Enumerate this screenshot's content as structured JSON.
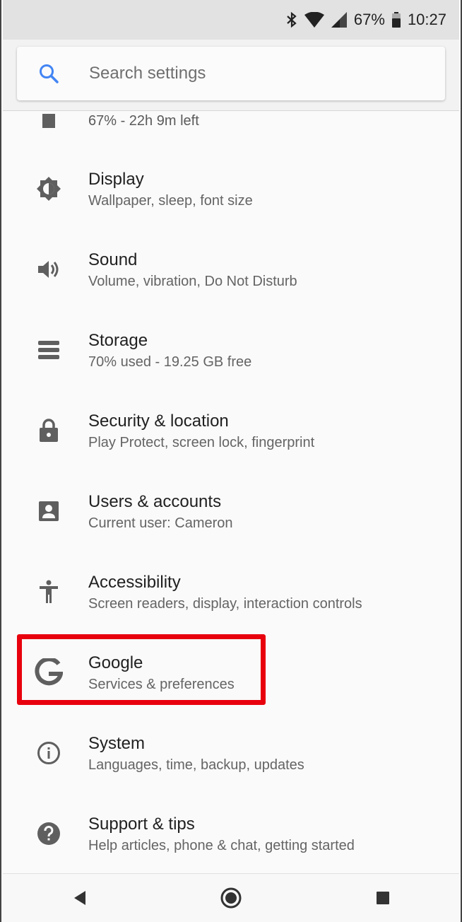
{
  "status_bar": {
    "battery": "67%",
    "time": "10:27"
  },
  "search": {
    "placeholder": "Search settings"
  },
  "battery_partial": {
    "summary": "67% - 22h 9m left"
  },
  "items": [
    {
      "title": "Display",
      "subtitle": "Wallpaper, sleep, font size",
      "icon": "brightness-icon"
    },
    {
      "title": "Sound",
      "subtitle": "Volume, vibration, Do Not Disturb",
      "icon": "volume-icon"
    },
    {
      "title": "Storage",
      "subtitle": "70% used - 19.25 GB free",
      "icon": "storage-icon"
    },
    {
      "title": "Security & location",
      "subtitle": "Play Protect, screen lock, fingerprint",
      "icon": "lock-icon"
    },
    {
      "title": "Users & accounts",
      "subtitle": "Current user: Cameron",
      "icon": "account-box-icon"
    },
    {
      "title": "Accessibility",
      "subtitle": "Screen readers, display, interaction controls",
      "icon": "accessibility-icon"
    },
    {
      "title": "Google",
      "subtitle": "Services & preferences",
      "icon": "google-icon"
    },
    {
      "title": "System",
      "subtitle": "Languages, time, backup, updates",
      "icon": "info-icon"
    },
    {
      "title": "Support & tips",
      "subtitle": "Help articles, phone & chat, getting started",
      "icon": "help-icon"
    }
  ],
  "colors": {
    "accent": "#4285f4",
    "highlight": "#e8000d",
    "icon": "#5f5f5f"
  }
}
